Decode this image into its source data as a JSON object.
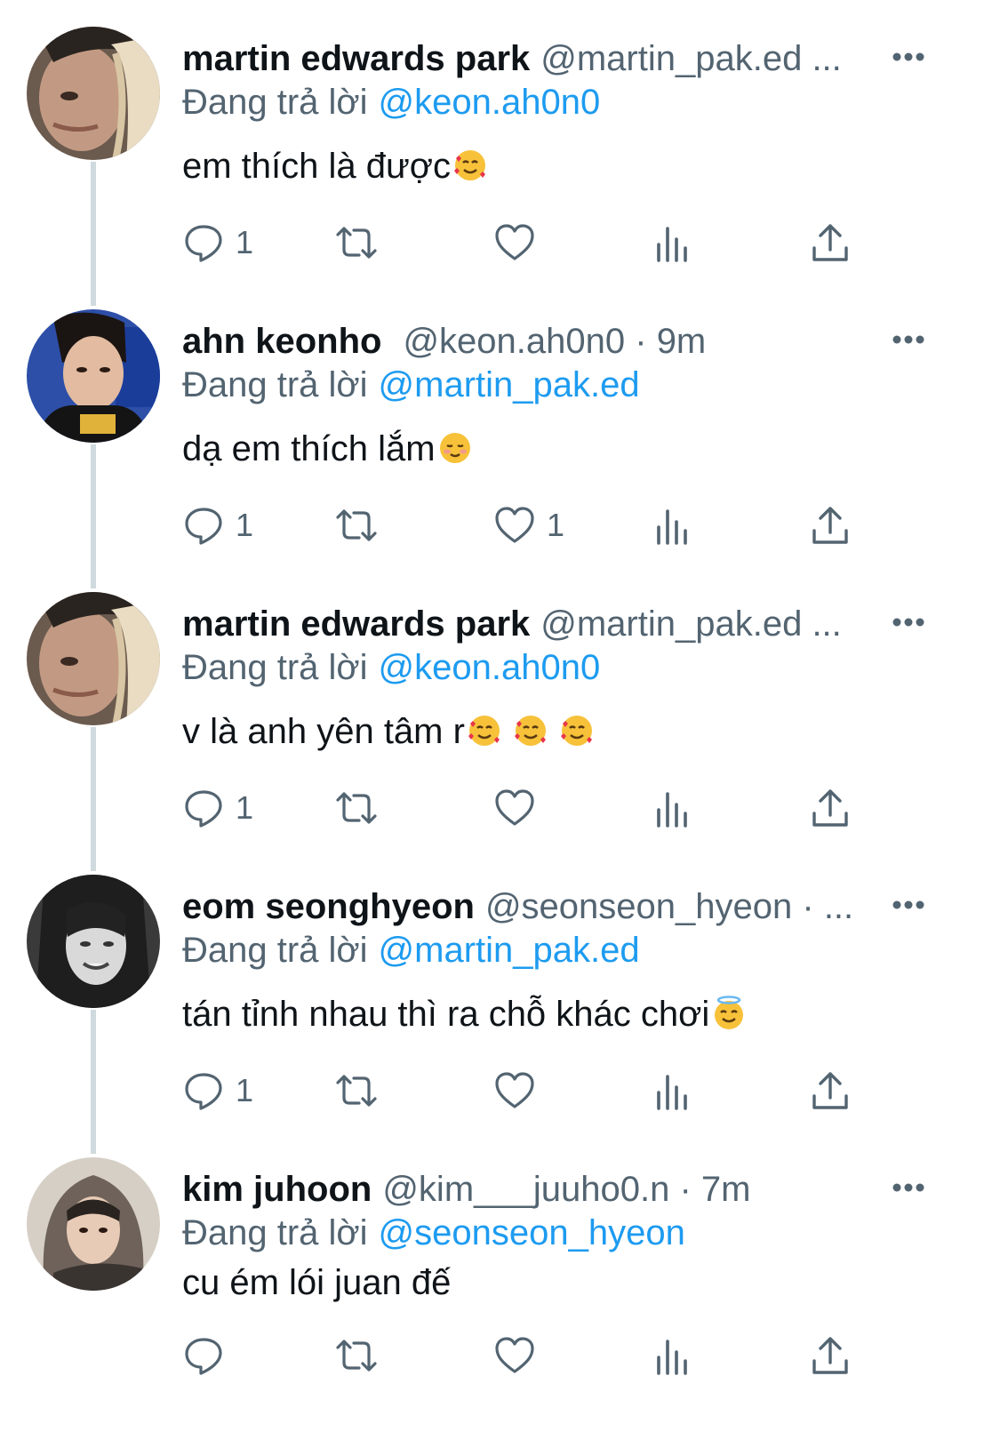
{
  "colors": {
    "accent": "#1d9bf0",
    "secondary": "#536471",
    "thread_line": "#cfd9de"
  },
  "tweets": [
    {
      "name": "martin edwards park",
      "handle": "@martin_pak.ed ...",
      "replying_label": "Đang trả lời",
      "replying_to": "@keon.ah0n0",
      "text": "em thích là được",
      "emojis": [
        "smiling-face-with-hearts"
      ],
      "reply_count": "1",
      "like_count": ""
    },
    {
      "name": "ahn keonho",
      "handle": "@keon.ah0n0 · 9m",
      "replying_label": "Đang trả lời",
      "replying_to": "@martin_pak.ed",
      "text": "dạ em thích lắm",
      "emojis": [
        "smiling-face"
      ],
      "reply_count": "1",
      "like_count": "1"
    },
    {
      "name": "martin edwards park",
      "handle": "@martin_pak.ed ...",
      "replying_label": "Đang trả lời",
      "replying_to": "@keon.ah0n0",
      "text": "v là anh yên tâm r",
      "emojis": [
        "smiling-face-with-hearts",
        "smiling-face-with-hearts",
        "smiling-face-with-hearts"
      ],
      "reply_count": "1",
      "like_count": ""
    },
    {
      "name": "eom seonghyeon",
      "handle": "@seonseon_hyeon · ...",
      "replying_label": "Đang trả lời",
      "replying_to": "@martin_pak.ed",
      "text": "tán tỉnh nhau thì ra chỗ khác chơi",
      "emojis": [
        "smiling-face-with-halo"
      ],
      "reply_count": "1",
      "like_count": ""
    },
    {
      "name": "kim juhoon",
      "handle": "@kim___juuho0.n · 7m",
      "replying_label": "Đang trả lời",
      "replying_to": "@seonseon_hyeon",
      "text": "cu ém lói juan đế",
      "emojis": [],
      "reply_count": "",
      "like_count": ""
    }
  ],
  "icons": [
    "reply-icon",
    "retweet-icon",
    "like-icon",
    "views-icon",
    "share-icon",
    "more-icon"
  ]
}
